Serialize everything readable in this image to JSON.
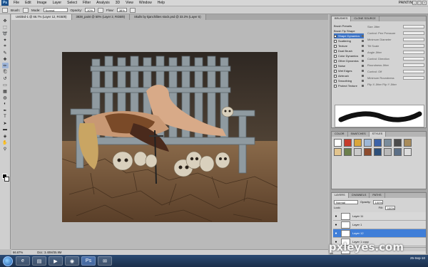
{
  "app": {
    "logo": "Ps",
    "workspace": "PAINTING"
  },
  "menu": [
    "File",
    "Edit",
    "Image",
    "Layer",
    "Select",
    "Filter",
    "Analysis",
    "3D",
    "View",
    "Window",
    "Help"
  ],
  "options": {
    "brush_label": "Brush:",
    "mode_label": "Mode:",
    "mode_value": "Normal",
    "opacity_label": "Opacity:",
    "opacity_value": "10%",
    "flow_label": "Flow:",
    "flow_value": "38%"
  },
  "tabs": [
    "Untitled-1 @ 66.7% (Layer 12, RGB/8)",
    "3838_paint @ 50% (Layer 2, RGB/8)",
    "Skulls by kjanchilites stock.psd @ 33.3% (Layer 5)"
  ],
  "tools": [
    "move-icon",
    "marquee-icon",
    "lasso-icon",
    "wand-icon",
    "crop-icon",
    "eyedropper-icon",
    "heal-icon",
    "brush-icon",
    "stamp-icon",
    "history-brush-icon",
    "eraser-icon",
    "gradient-icon",
    "blur-icon",
    "dodge-icon",
    "pen-icon",
    "type-icon",
    "path-select-icon",
    "shape-icon",
    "3d-icon",
    "hand-icon",
    "zoom-icon"
  ],
  "tool_glyphs": [
    "✥",
    "⬚",
    "➰",
    "✦",
    "⌗",
    "✎",
    "✚",
    "✏",
    "⎗",
    "↺",
    "▭",
    "▦",
    "◍",
    "◐",
    "✒",
    "T",
    "➤",
    "▬",
    "◈",
    "✋",
    "⚲"
  ],
  "status": {
    "zoom": "66.67%",
    "doc": "Doc: 3.40M/35.9M"
  },
  "brushes_panel": {
    "tabs": [
      "BRUSHES",
      "CLONE SOURCE"
    ],
    "items": [
      "Brush Presets",
      "Brush Tip Shape",
      "Shape Dynamics",
      "Scattering",
      "Texture",
      "Dual Brush",
      "Color Dynamics",
      "Other Dynamics",
      "Noise",
      "Wet Edges",
      "Airbrush",
      "Smoothing",
      "Protect Texture"
    ],
    "controls": [
      "Size Jitter",
      "Control: Pen Pressure",
      "Minimum Diameter",
      "Tilt Scale",
      "Angle Jitter",
      "Control: Direction",
      "Roundness Jitter",
      "Control: Off",
      "Minimum Roundness",
      "Flip X Jitter  Flip Y Jitter"
    ]
  },
  "styles_panel": {
    "tabs": [
      "COLOR",
      "SWATCHES",
      "STYLES"
    ],
    "swatch_colors": [
      "#ffffff",
      "#c63b2c",
      "#d9a53b",
      "#9db7d6",
      "#3b62a8",
      "#7a8c9b",
      "#4b4b4b",
      "#a88b5a",
      "#e2c48e",
      "#6b7f4c",
      "#c9c9c9",
      "#8d4b2e",
      "#2d4f7a",
      "#b9b9b9",
      "#5c6f86",
      "#dcdcdc"
    ]
  },
  "layers_panel": {
    "tabs": [
      "LAYERS",
      "CHANNELS",
      "PATHS"
    ],
    "blend": "Normal",
    "opacity_label": "Opacity:",
    "opacity": "100%",
    "lock_label": "Lock:",
    "fill_label": "Fill:",
    "fill": "100%",
    "layers": [
      {
        "name": "Layer 11",
        "selected": false
      },
      {
        "name": "Layer 1",
        "selected": false
      },
      {
        "name": "Layer 12",
        "selected": true
      },
      {
        "name": "Layer 1 copy",
        "selected": false
      },
      {
        "name": "Layer 2",
        "selected": false
      }
    ]
  },
  "taskbar": {
    "apps": [
      "ie-icon",
      "folder-icon",
      "media-icon",
      "firefox-icon",
      "photoshop-icon",
      "messenger-icon"
    ]
  },
  "watermark": "pxleyes.com",
  "clock": {
    "time": "",
    "date": "25-Sep-10"
  },
  "colors": {
    "accent": "#3f7ed8",
    "panel": "#d3d3d3",
    "chrome": "#bdbdbd"
  }
}
